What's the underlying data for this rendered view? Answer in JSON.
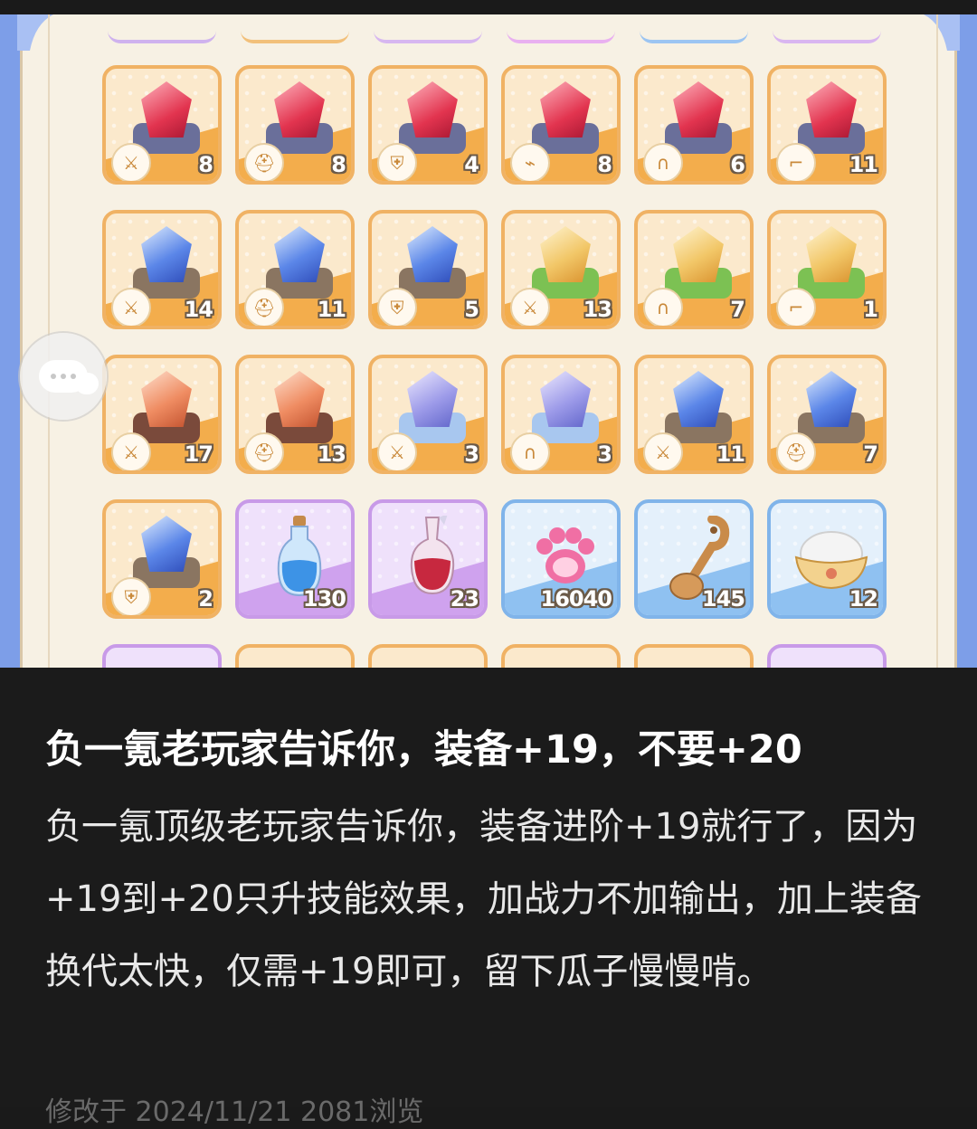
{
  "game": {
    "inventory": [
      [
        {
          "frame": "orange",
          "gem": "red",
          "base": "rock-grey",
          "equip": "sword",
          "equip_glyph": "⚔",
          "count": "8"
        },
        {
          "frame": "orange",
          "gem": "red",
          "base": "rock-grey",
          "equip": "helmet",
          "equip_glyph": "⛑",
          "count": "8"
        },
        {
          "frame": "orange",
          "gem": "red",
          "base": "rock-grey",
          "equip": "armor",
          "equip_glyph": "⛨",
          "count": "4"
        },
        {
          "frame": "orange",
          "gem": "red",
          "base": "rock-grey",
          "equip": "bracer",
          "equip_glyph": "⌁",
          "count": "8"
        },
        {
          "frame": "orange",
          "gem": "red",
          "base": "rock-grey",
          "equip": "pants",
          "equip_glyph": "∩",
          "count": "6"
        },
        {
          "frame": "orange",
          "gem": "red",
          "base": "rock-grey",
          "equip": "boots",
          "equip_glyph": "⌐",
          "count": "11"
        }
      ],
      [
        {
          "frame": "orange",
          "gem": "blue",
          "base": "rock-brown",
          "equip": "sword",
          "equip_glyph": "⚔",
          "count": "14"
        },
        {
          "frame": "orange",
          "gem": "blue",
          "base": "rock-brown",
          "equip": "helmet",
          "equip_glyph": "⛑",
          "count": "11"
        },
        {
          "frame": "orange",
          "gem": "blue",
          "base": "rock-brown",
          "equip": "armor",
          "equip_glyph": "⛨",
          "count": "5"
        },
        {
          "frame": "orange",
          "gem": "yellow",
          "base": "leaf",
          "equip": "sword",
          "equip_glyph": "⚔",
          "count": "13"
        },
        {
          "frame": "orange",
          "gem": "yellow",
          "base": "leaf",
          "equip": "pants",
          "equip_glyph": "∩",
          "count": "7"
        },
        {
          "frame": "orange",
          "gem": "yellow",
          "base": "leaf",
          "equip": "boots",
          "equip_glyph": "⌐",
          "count": "1"
        }
      ],
      [
        {
          "frame": "orange",
          "gem": "orange",
          "base": "ember",
          "equip": "sword",
          "equip_glyph": "⚔",
          "count": "17"
        },
        {
          "frame": "orange",
          "gem": "orange",
          "base": "ember",
          "equip": "helmet",
          "equip_glyph": "⛑",
          "count": "13"
        },
        {
          "frame": "orange",
          "gem": "violet",
          "base": "crystal",
          "equip": "sword",
          "equip_glyph": "⚔",
          "count": "3"
        },
        {
          "frame": "orange",
          "gem": "violet",
          "base": "crystal",
          "equip": "pants",
          "equip_glyph": "∩",
          "count": "3"
        },
        {
          "frame": "orange",
          "gem": "blue",
          "base": "rock-brown",
          "equip": "sword",
          "equip_glyph": "⚔",
          "count": "11"
        },
        {
          "frame": "orange",
          "gem": "blue",
          "base": "rock-brown",
          "equip": "helmet",
          "equip_glyph": "⛑",
          "count": "7"
        }
      ],
      [
        {
          "frame": "orange",
          "gem": "blue",
          "base": "rock-brown",
          "equip": "armor",
          "equip_glyph": "⛨",
          "count": "2"
        },
        {
          "frame": "purple",
          "item": "blue-potion",
          "count": "130"
        },
        {
          "frame": "purple",
          "item": "red-potion",
          "count": "23"
        },
        {
          "frame": "blue",
          "item": "paw",
          "count": "16040"
        },
        {
          "frame": "blue",
          "item": "spoon",
          "count": "145"
        },
        {
          "frame": "blue",
          "item": "rice-bowl",
          "count": "12"
        }
      ]
    ],
    "top_peek_colors": [
      "#cfb2ee",
      "#f2c07a",
      "#d7b7f0",
      "#e9b0f0",
      "#9cc5f2",
      "#d9b6f0"
    ],
    "bottom_peek_frames": [
      "purple",
      "orange",
      "orange",
      "orange",
      "orange",
      "purple"
    ]
  },
  "post": {
    "title": "负一氪老玩家告诉你，装备+19，不要+20",
    "body": "负一氪顶级老玩家告诉你，装备进阶+19就行了，因为+19到+20只升技能效果，加战力不加输出，加上装备换代太快，仅需+19即可，留下瓜子慢慢啃。",
    "footer": "修改于 2024/11/21  2081浏览"
  },
  "chat_icon": "chat-bubble-icon"
}
